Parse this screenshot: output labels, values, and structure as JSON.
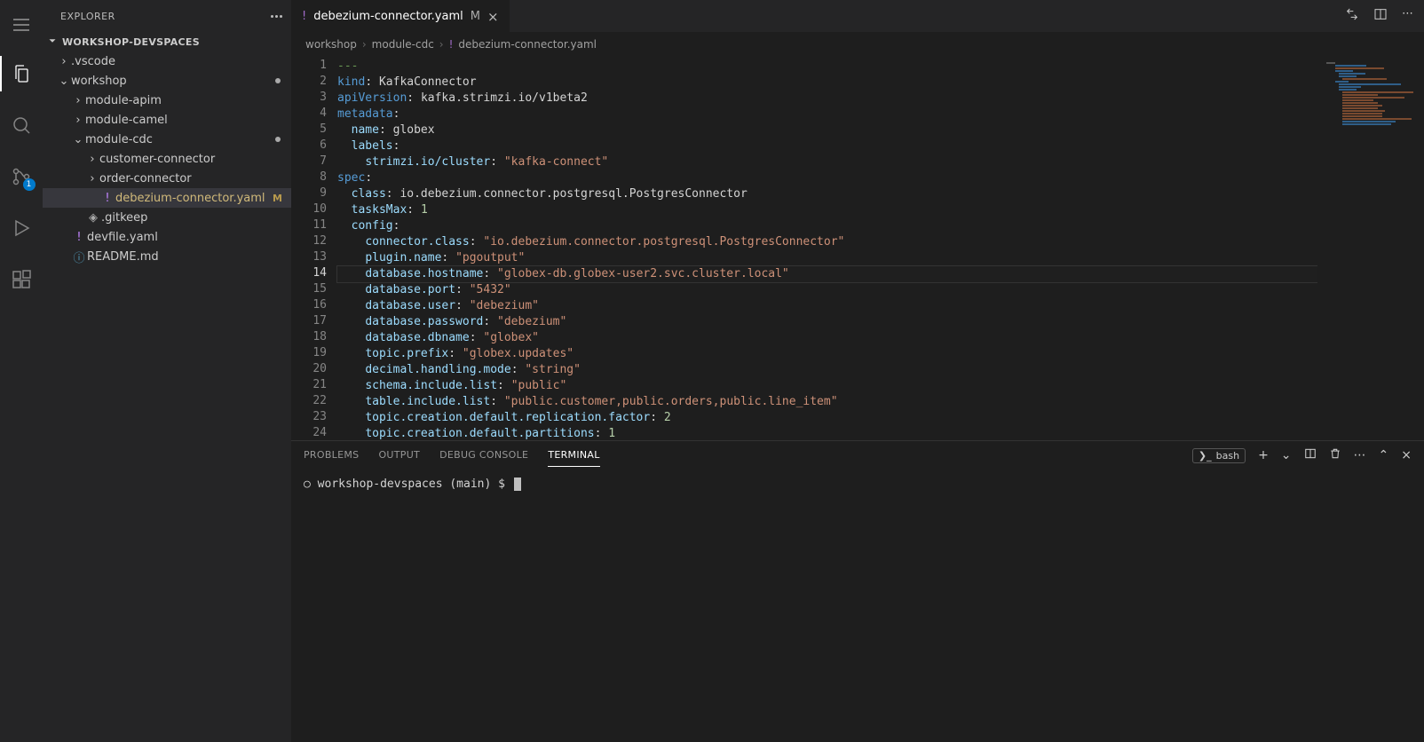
{
  "sidebar": {
    "title": "EXPLORER",
    "root": "WORKSHOP-DEVSPACES",
    "tree": {
      "vscode": ".vscode",
      "workshop": "workshop",
      "module_apim": "module-apim",
      "module_camel": "module-camel",
      "module_cdc": "module-cdc",
      "customer_connector": "customer-connector",
      "order_connector": "order-connector",
      "debezium_file": "debezium-connector.yaml",
      "debezium_tag": "M",
      "gitkeep": ".gitkeep",
      "devfile": "devfile.yaml",
      "readme": "README.md"
    }
  },
  "tab": {
    "filename": "debezium-connector.yaml",
    "modified": "M"
  },
  "breadcrumbs": {
    "p1": "workshop",
    "p2": "module-cdc",
    "p3": "debezium-connector.yaml"
  },
  "code_raw": {
    "1": "---",
    "2": "kind: KafkaConnector",
    "3": "apiVersion: kafka.strimzi.io/v1beta2",
    "4": "metadata:",
    "5": "  name: globex",
    "6": "  labels:",
    "7": "    strimzi.io/cluster: \"kafka-connect\"",
    "8": "spec:",
    "9": "  class: io.debezium.connector.postgresql.PostgresConnector",
    "10": "  tasksMax: 1",
    "11": "  config:",
    "12": "    connector.class: \"io.debezium.connector.postgresql.PostgresConnector\"",
    "13": "    plugin.name: \"pgoutput\"",
    "14": "    database.hostname: \"globex-db.globex-user2.svc.cluster.local\"",
    "15": "    database.port: \"5432\"",
    "16": "    database.user: \"debezium\"",
    "17": "    database.password: \"debezium\"",
    "18": "    database.dbname: \"globex\"",
    "19": "    topic.prefix: \"globex.updates\"",
    "20": "    decimal.handling.mode: \"string\"",
    "21": "    schema.include.list: \"public\"",
    "22": "    table.include.list: \"public.customer,public.orders,public.line_item\"",
    "23": "    topic.creation.default.replication.factor: 2",
    "24": "    topic.creation.default.partitions: 1"
  },
  "current_line": 14,
  "panel": {
    "tabs": {
      "problems": "PROBLEMS",
      "output": "OUTPUT",
      "debug": "DEBUG CONSOLE",
      "terminal": "TERMINAL"
    },
    "shell": "bash",
    "prompt": "○ workshop-devspaces (main) $ "
  },
  "scm_badge": "1"
}
